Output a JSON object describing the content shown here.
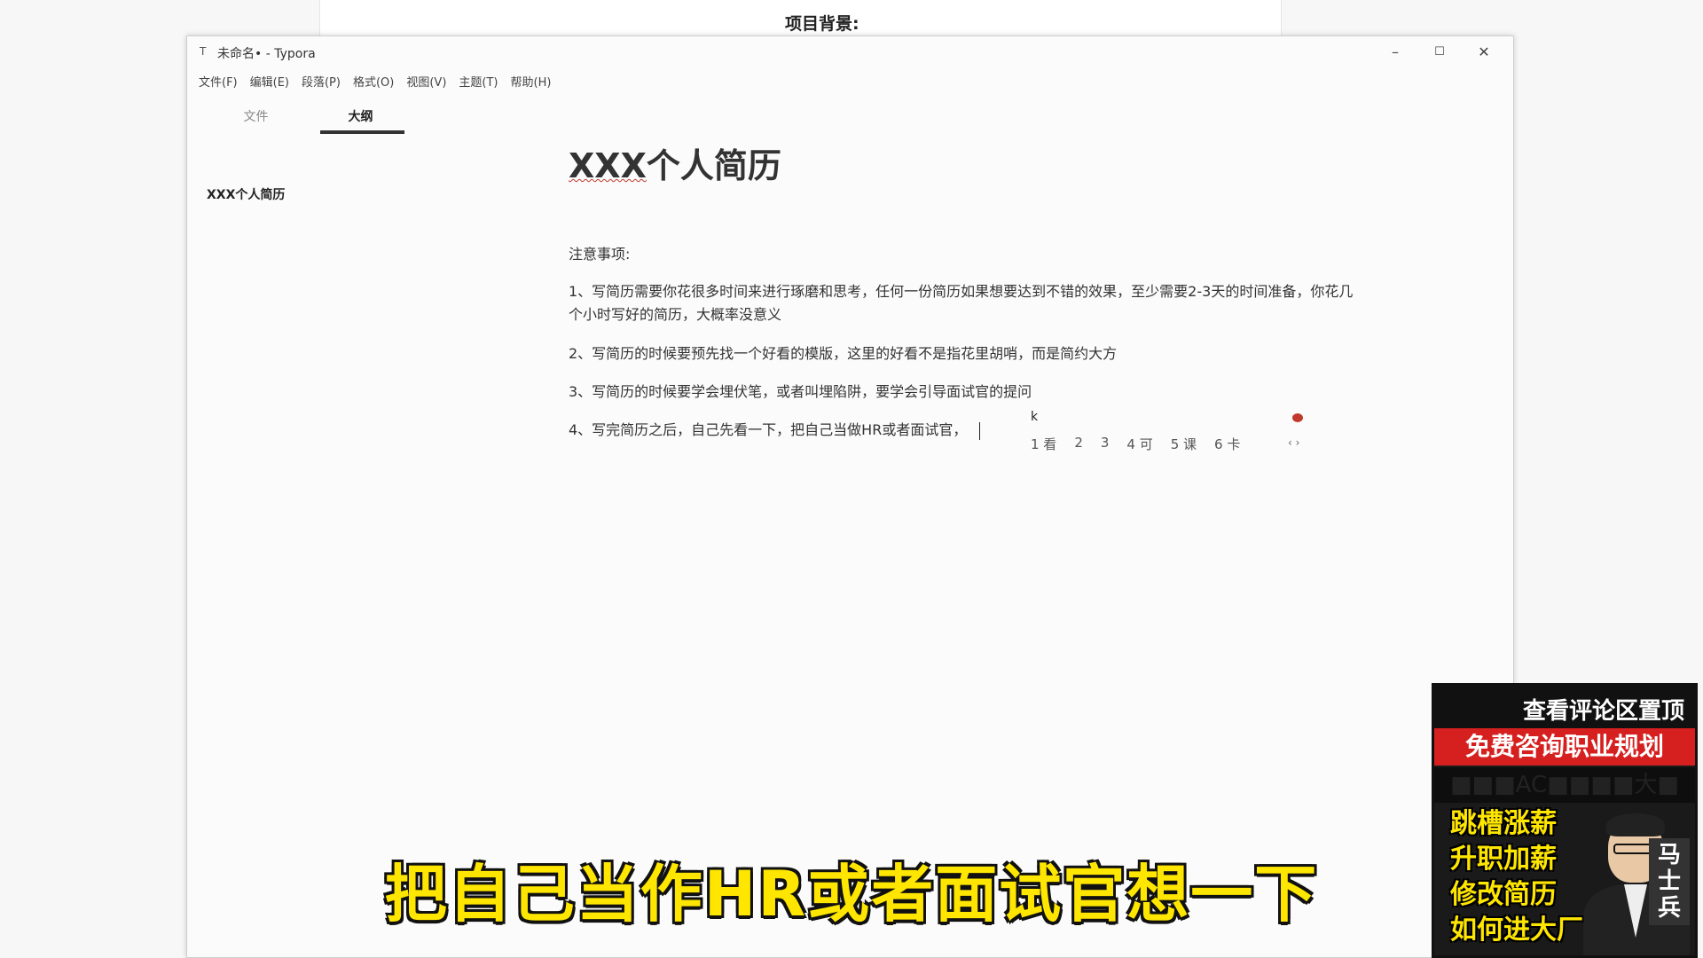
{
  "background": {
    "heading": "项目背景:"
  },
  "window": {
    "app_icon": "T",
    "title": "未命名• - Typora",
    "controls": {
      "minimize": "–",
      "maximize": "☐",
      "close": "✕"
    }
  },
  "menubar": {
    "items": [
      "文件(F)",
      "编辑(E)",
      "段落(P)",
      "格式(O)",
      "视图(V)",
      "主题(T)",
      "帮助(H)"
    ]
  },
  "sidebar": {
    "tabs": {
      "files": "文件",
      "outline": "大纲"
    },
    "active_tab": "outline",
    "outline_items": [
      "XXX个人简历"
    ]
  },
  "document": {
    "title_prefix": "XXX",
    "title_suffix": "个人简历",
    "note_label": "注意事项:",
    "paragraphs": [
      "1、写简历需要你花很多时间来进行琢磨和思考，任何一份简历如果想要达到不错的效果，至少需要2-3天的时间准备，你花几个小时写好的简历，大概率没意义",
      "2、写简历的时候要预先找一个好看的模版，这里的好看不是指花里胡哨，而是简约大方",
      "3、写简历的时候要学会埋伏笔，或者叫埋陷阱，要学会引导面试官的提问",
      "4、写完简历之后，自己先看一下，把自己当做HR或者面试官，"
    ]
  },
  "ime": {
    "input": "k",
    "candidates": [
      "1 看",
      "2",
      "3",
      "4 可",
      "5 课",
      "6 卡"
    ],
    "arrows": "‹ ›"
  },
  "subtitle": "把自己当作HR或者面试官想一下",
  "promo": {
    "top": "查看评论区置顶",
    "red_banner": "免费咨询职业规划",
    "dark_banner": "■■■AC■■■■大■",
    "lines": [
      "跳槽涨薪",
      "升职加薪",
      "修改简历",
      "如何进大厂"
    ],
    "brand": "马士兵"
  },
  "colors": {
    "subtitle_text": "#ffe600",
    "promo_red": "#d62020",
    "spellcheck_underline": "#c0392b"
  }
}
